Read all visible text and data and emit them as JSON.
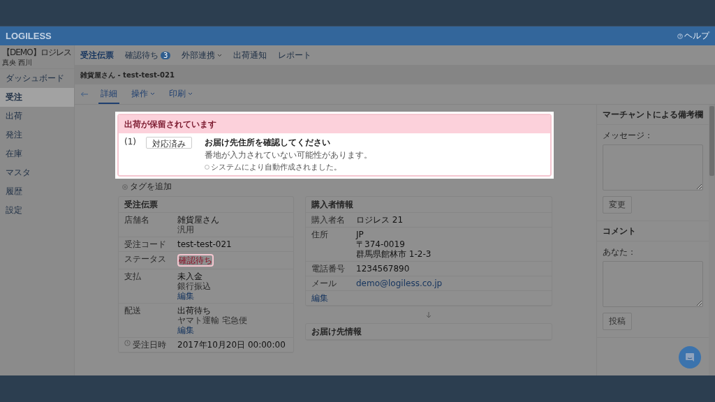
{
  "brand": "LOGILESS",
  "help": "ヘルプ",
  "account": {
    "name": "【DEMO】ロジレス",
    "user": "真央 西川"
  },
  "sidebar": [
    {
      "label": "ダッシュボード",
      "selected": false
    },
    {
      "label": "受注",
      "selected": true
    },
    {
      "label": "出荷",
      "selected": false
    },
    {
      "label": "発注",
      "selected": false
    },
    {
      "label": "在庫",
      "selected": false
    },
    {
      "label": "マスタ",
      "selected": false
    },
    {
      "label": "履歴",
      "selected": false
    },
    {
      "label": "設定",
      "selected": false
    }
  ],
  "tabs": [
    {
      "label": "受注伝票",
      "selected": true,
      "dropdown": false
    },
    {
      "label": "確認待ち",
      "badge": "3",
      "selected": false,
      "dropdown": false
    },
    {
      "label": "外部連携",
      "selected": false,
      "dropdown": true
    },
    {
      "label": "出荷通知",
      "selected": false,
      "dropdown": false
    },
    {
      "label": "レポート",
      "selected": false,
      "dropdown": false
    }
  ],
  "page_title": "雑貨屋さん - test-test-021",
  "subtabs": [
    {
      "label": "詳細",
      "selected": true,
      "dropdown": false
    },
    {
      "label": "操作",
      "selected": false,
      "dropdown": true
    },
    {
      "label": "印刷",
      "selected": false,
      "dropdown": true
    }
  ],
  "alert": {
    "title": "出荷が保留されています",
    "items": [
      {
        "index": "(1)",
        "button": "対応済み",
        "heading": "お届け先住所を確認してください",
        "detail": "番地が入力されていない可能性があります。",
        "note": "システムにより自動作成されました。"
      }
    ]
  },
  "add_tag": "タグを追加",
  "order_card": {
    "title": "受注伝票",
    "rows": [
      {
        "label": "店舗名",
        "kind": "plain",
        "lines": [
          {
            "text": "雑貨屋さん",
            "kind": "primary"
          },
          {
            "text": "汎用",
            "kind": "muted"
          }
        ]
      },
      {
        "label": "受注コード",
        "kind": "plain",
        "lines": [
          {
            "text": "test-test-021",
            "kind": "primary"
          }
        ]
      },
      {
        "label": "ステータス",
        "kind": "plain",
        "lines": [
          {
            "text": "確認待ち",
            "kind": "alert"
          }
        ]
      },
      {
        "label": "支払",
        "kind": "plain",
        "lines": [
          {
            "text": "未入金",
            "kind": "primary"
          },
          {
            "text": "銀行振込",
            "kind": "muted"
          },
          {
            "text": "編集",
            "kind": "link"
          }
        ]
      },
      {
        "label": "配送",
        "kind": "plain",
        "lines": [
          {
            "text": "出荷待ち",
            "kind": "primary"
          },
          {
            "text": "ヤマト運輸 宅急便",
            "kind": "muted"
          },
          {
            "text": "編集",
            "kind": "link"
          }
        ]
      },
      {
        "label": "受注日時",
        "kind": "timestamp",
        "lines": [
          {
            "text": "2017年10月20日 00:00:00",
            "kind": "primary"
          }
        ]
      }
    ]
  },
  "buyer_card": {
    "title": "購入者情報",
    "rows": [
      {
        "label": "購入者名",
        "lines": [
          {
            "text": "ロジレス 21",
            "kind": "primary"
          }
        ]
      },
      {
        "label": "住所",
        "lines": [
          {
            "text": "JP",
            "kind": "primary"
          },
          {
            "text": "〒374-0019",
            "kind": "primary"
          },
          {
            "text": "群馬県館林市 1-2-3",
            "kind": "primary"
          }
        ]
      },
      {
        "label": "電話番号",
        "lines": [
          {
            "text": "1234567890",
            "kind": "primary"
          }
        ]
      },
      {
        "label": "メール",
        "lines": [
          {
            "text": "demo@logiless.co.jp",
            "kind": "link"
          }
        ]
      }
    ],
    "edit_link": "編集"
  },
  "delivery_card": {
    "title": "お届け先情報"
  },
  "merchant_notes": {
    "title": "マーチャントによる備考欄",
    "label": "メッセージ：",
    "button": "変更"
  },
  "comments": {
    "title": "コメント",
    "label": "あなた：",
    "button": "投稿"
  }
}
